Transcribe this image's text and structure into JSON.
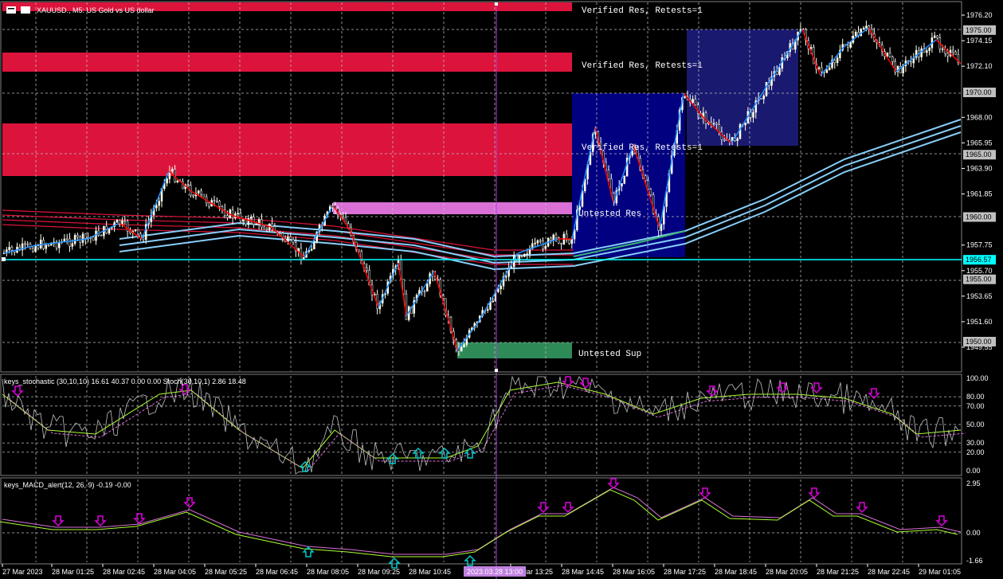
{
  "header": {
    "symbol_title": "XAUUSD., M5:  US Gold vs US dollar"
  },
  "colors": {
    "background": "#000000",
    "grid": "#c0c0c0",
    "resistance_zone": "#dc143c",
    "untested_res_zone": "#da70d6",
    "support_zone": "#2e8b57",
    "box_blue": "#000080",
    "box_dark": "#191970",
    "current_price_line": "#00ffff",
    "candle_up": "#ffffe0",
    "candle_down": "#ffffff",
    "zigzag_up": "#1e90ff",
    "zigzag_down": "#ff0000",
    "ma_red": "#dc143c",
    "ma_blue": "#1e90ff",
    "stoch_signal": "#da70d6",
    "arrow_down": "#da00da",
    "arrow_up": "#00c8c8"
  },
  "price_axis": {
    "labels": [
      "1976.20",
      "1974.15",
      "1972.10",
      "1968.00",
      "1965.95",
      "1963.90",
      "1961.85",
      "1957.75",
      "1955.70",
      "1953.65",
      "1951.60",
      "1949.55"
    ],
    "boxed": [
      "1975.00",
      "1970.00",
      "1965.00",
      "1960.00",
      "1956.57",
      "1955.00",
      "1950.00"
    ]
  },
  "zone_labels": {
    "res1": "Verified Res, Retests=1",
    "res2": "Verified Res, Retests=1",
    "res3": "Verified Res, Retests=1",
    "untested_res": "Untested Res",
    "untested_sup": "Untested Sup"
  },
  "stochastic": {
    "title": "keys_stochastic (30,10,10) 16.61 40.37 0.00 0.00 Stoch(30,10,1) 2.86 18.48",
    "levels": [
      "100.00",
      "80.00",
      "70.00",
      "50.00",
      "30.00",
      "20.00",
      "0.00"
    ]
  },
  "macd": {
    "title": "keys_MACD_alert(12, 26, 9) -0.19 -0.00",
    "levels": [
      "2.95",
      "0.00",
      "-1.66"
    ]
  },
  "time_axis": {
    "labels": [
      "27 Mar 2023",
      "28 Mar 01:25",
      "28 Mar 02:45",
      "28 Mar 04:05",
      "28 Mar 05:25",
      "28 Mar 06:45",
      "28 Mar 08:05",
      "28 Mar 09:25",
      "28 Mar 10:45",
      "28 Mar 13:25",
      "28 Mar 14:45",
      "28 Mar 16:05",
      "28 Mar 17:25",
      "28 Mar 18:45",
      "28 Mar 20:05",
      "28 Mar 21:25",
      "28 Mar 22:45",
      "29 Mar 01:05"
    ],
    "crosshair_time": "2023.03.28 13:00"
  }
}
